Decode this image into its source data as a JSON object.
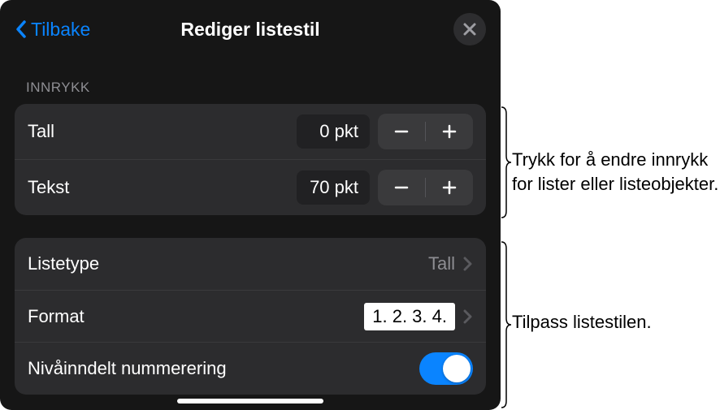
{
  "header": {
    "back": "Tilbake",
    "title": "Rediger listestil"
  },
  "section_indent": {
    "header": "INNRYKK",
    "rows": [
      {
        "label": "Tall",
        "value": "0 pkt"
      },
      {
        "label": "Tekst",
        "value": "70 pkt"
      }
    ]
  },
  "section_style": {
    "list_type_label": "Listetype",
    "list_type_value": "Tall",
    "format_label": "Format",
    "format_value": "1. 2. 3. 4.",
    "tiered_label": "Nivåinndelt nummerering"
  },
  "callouts": {
    "indent": "Trykk for å endre innrykk for lister eller listeobjekter.",
    "style": "Tilpass listestilen."
  }
}
